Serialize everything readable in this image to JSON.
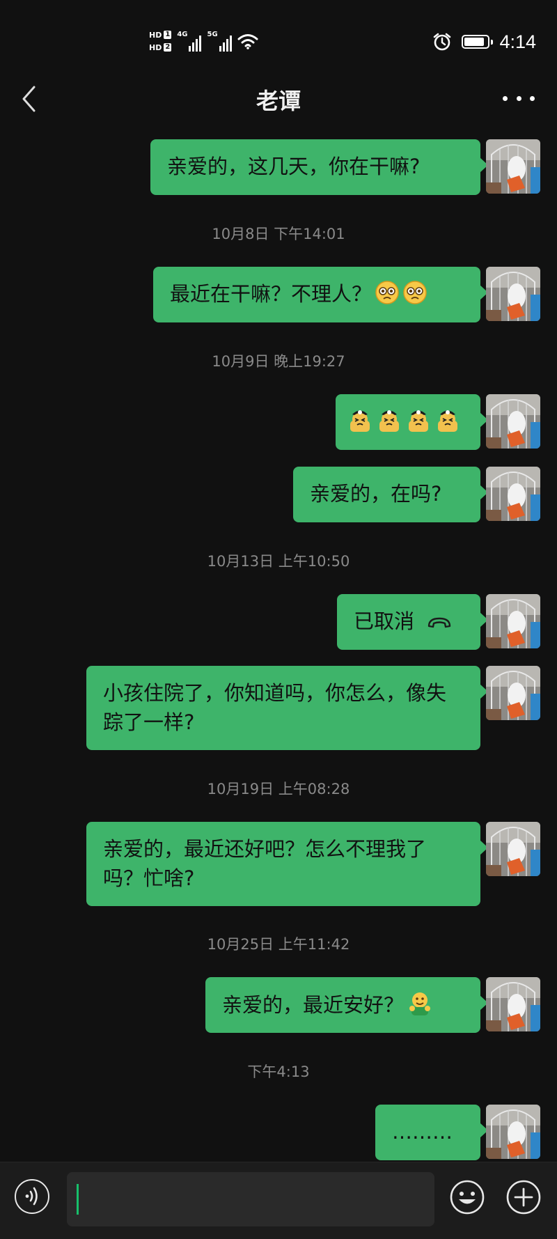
{
  "status_bar": {
    "sim1": "HD",
    "sim1_num": "1",
    "sim2": "HD",
    "sim2_num": "2",
    "network1": "4G",
    "network2": "5G",
    "time": "4:14",
    "battery_level": 0.9,
    "icons": [
      "signal-4g-icon",
      "signal-5g-icon",
      "wifi-icon",
      "alarm-icon",
      "battery-icon"
    ]
  },
  "header": {
    "title": "老谭",
    "back_icon": "chevron-left-icon",
    "more_icon": "more-icon"
  },
  "messages": [
    {
      "type": "text",
      "text": "亲爱的，这几天，你在干嘛?"
    },
    {
      "type": "timestamp",
      "text": "10月8日 下午14:01"
    },
    {
      "type": "text",
      "text": "最近在干嘛？不理人？",
      "emoji": [
        "pleading-face-icon",
        "pleading-face-icon"
      ]
    },
    {
      "type": "timestamp",
      "text": "10月9日 晚上19:27"
    },
    {
      "type": "emoji",
      "emoji": [
        "mascot-frown-icon",
        "mascot-frown-icon",
        "mascot-frown-icon",
        "mascot-frown-icon"
      ]
    },
    {
      "type": "text",
      "text": "亲爱的，在吗?"
    },
    {
      "type": "timestamp",
      "text": "10月13日 上午10:50"
    },
    {
      "type": "call",
      "text": "已取消",
      "icon": "phone-hangup-icon"
    },
    {
      "type": "text",
      "text": "小孩住院了，你知道吗，你怎么，像失踪了一样?"
    },
    {
      "type": "timestamp",
      "text": "10月19日 上午08:28"
    },
    {
      "type": "text",
      "text": "亲爱的，最近还好吧？怎么不理我了吗？忙啥?"
    },
    {
      "type": "timestamp",
      "text": "10月25日 上午11:42"
    },
    {
      "type": "text",
      "text": "亲爱的，最近安好？",
      "emoji": [
        "hug-face-icon"
      ]
    },
    {
      "type": "timestamp",
      "text": "下午4:13"
    },
    {
      "type": "text",
      "text": "………"
    }
  ],
  "input_bar": {
    "voice_icon": "voice-icon",
    "input_value": "",
    "emoji_icon": "emoji-icon",
    "plus_icon": "plus-icon"
  },
  "colors": {
    "background": "#111111",
    "bubble": "#3eb46a",
    "timestamp": "#8a8a8a",
    "caret": "#17c06b"
  }
}
